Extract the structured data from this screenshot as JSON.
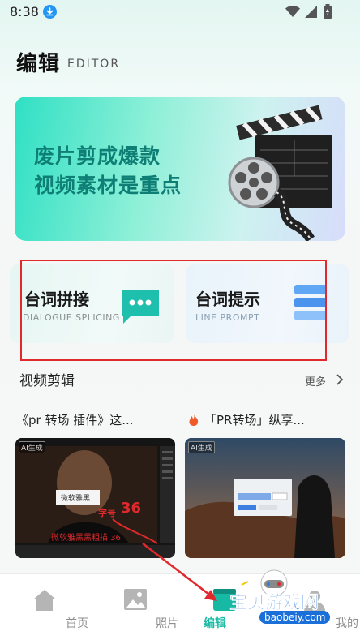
{
  "status_bar": {
    "time": "8:38"
  },
  "header": {
    "title": "编辑",
    "subtitle": "EDITOR"
  },
  "banner": {
    "line1": "废片剪成爆款",
    "line2": "视频素材是重点"
  },
  "cards": [
    {
      "title": "台词拼接",
      "subtitle": "DIALOGUE SPLICING"
    },
    {
      "title": "台词提示",
      "subtitle": "LINE PROMPT"
    }
  ],
  "section": {
    "title": "视频剪辑",
    "more": "更多"
  },
  "videos": [
    {
      "caption": "《pr 转场 插件》这...",
      "tag": "AI生成",
      "bottom_caption": ""
    },
    {
      "caption": "「PR转场」纵享...",
      "tag": "AI生成",
      "bottom_caption": ""
    }
  ],
  "thumb1_overlay": {
    "box_text": "微软雅黑",
    "label": "字号",
    "number": "36",
    "subtitle": "微软雅黑黑粗描 36"
  },
  "nav": [
    {
      "label": "首页",
      "icon": "home-icon"
    },
    {
      "label": "照片",
      "icon": "photo-icon"
    },
    {
      "label": "编辑",
      "icon": "edit-icon"
    },
    {
      "label": "我的",
      "icon": "profile-icon"
    }
  ],
  "watermark": {
    "text": "宝贝游戏网",
    "url": "baobeiy.com"
  },
  "colors": {
    "accent": "#18b9a4",
    "banner_text": "#0f7f76",
    "annotation": "#e0292c"
  }
}
